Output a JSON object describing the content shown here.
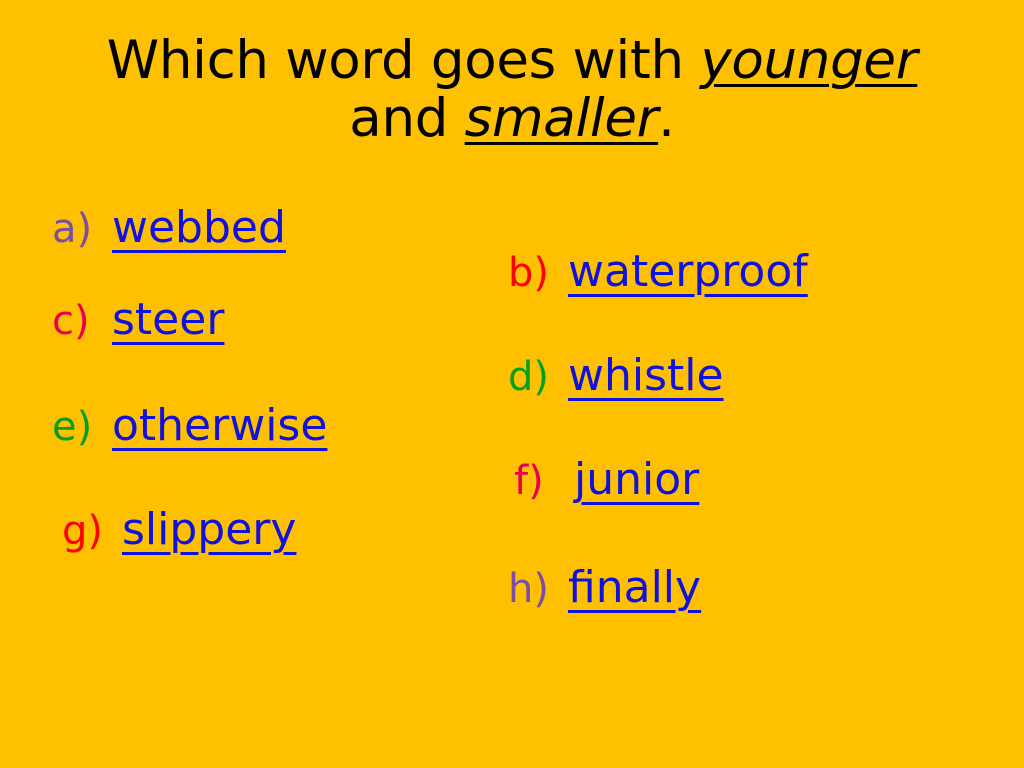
{
  "slide": {
    "background_color": "#FFC000",
    "answer_word_color": "#1111DD"
  },
  "question": {
    "line1_before": "Which word goes with ",
    "line1_emphasis": "younger",
    "line2_before": "and ",
    "line2_emphasis": "smaller",
    "line2_after": "."
  },
  "options": {
    "left": [
      {
        "letter": "a)",
        "word": "webbed",
        "letter_color": "#7A4FA3"
      },
      {
        "letter": "c)",
        "word": "steer",
        "letter_color": "#E8004F"
      },
      {
        "letter": "e)",
        "word": "otherwise",
        "letter_color": "#00A11E"
      },
      {
        "letter": "g)",
        "word": "slippery",
        "letter_color": "#FF0000"
      }
    ],
    "right": [
      {
        "letter": "b)",
        "word": "waterproof",
        "letter_color": "#FF0000"
      },
      {
        "letter": "d)",
        "word": "whistle",
        "letter_color": "#00A11E"
      },
      {
        "letter": "f)",
        "word": "junior",
        "letter_color": "#E8004F"
      },
      {
        "letter": "h)",
        "word": "finally",
        "letter_color": "#7A4FA3"
      }
    ]
  }
}
